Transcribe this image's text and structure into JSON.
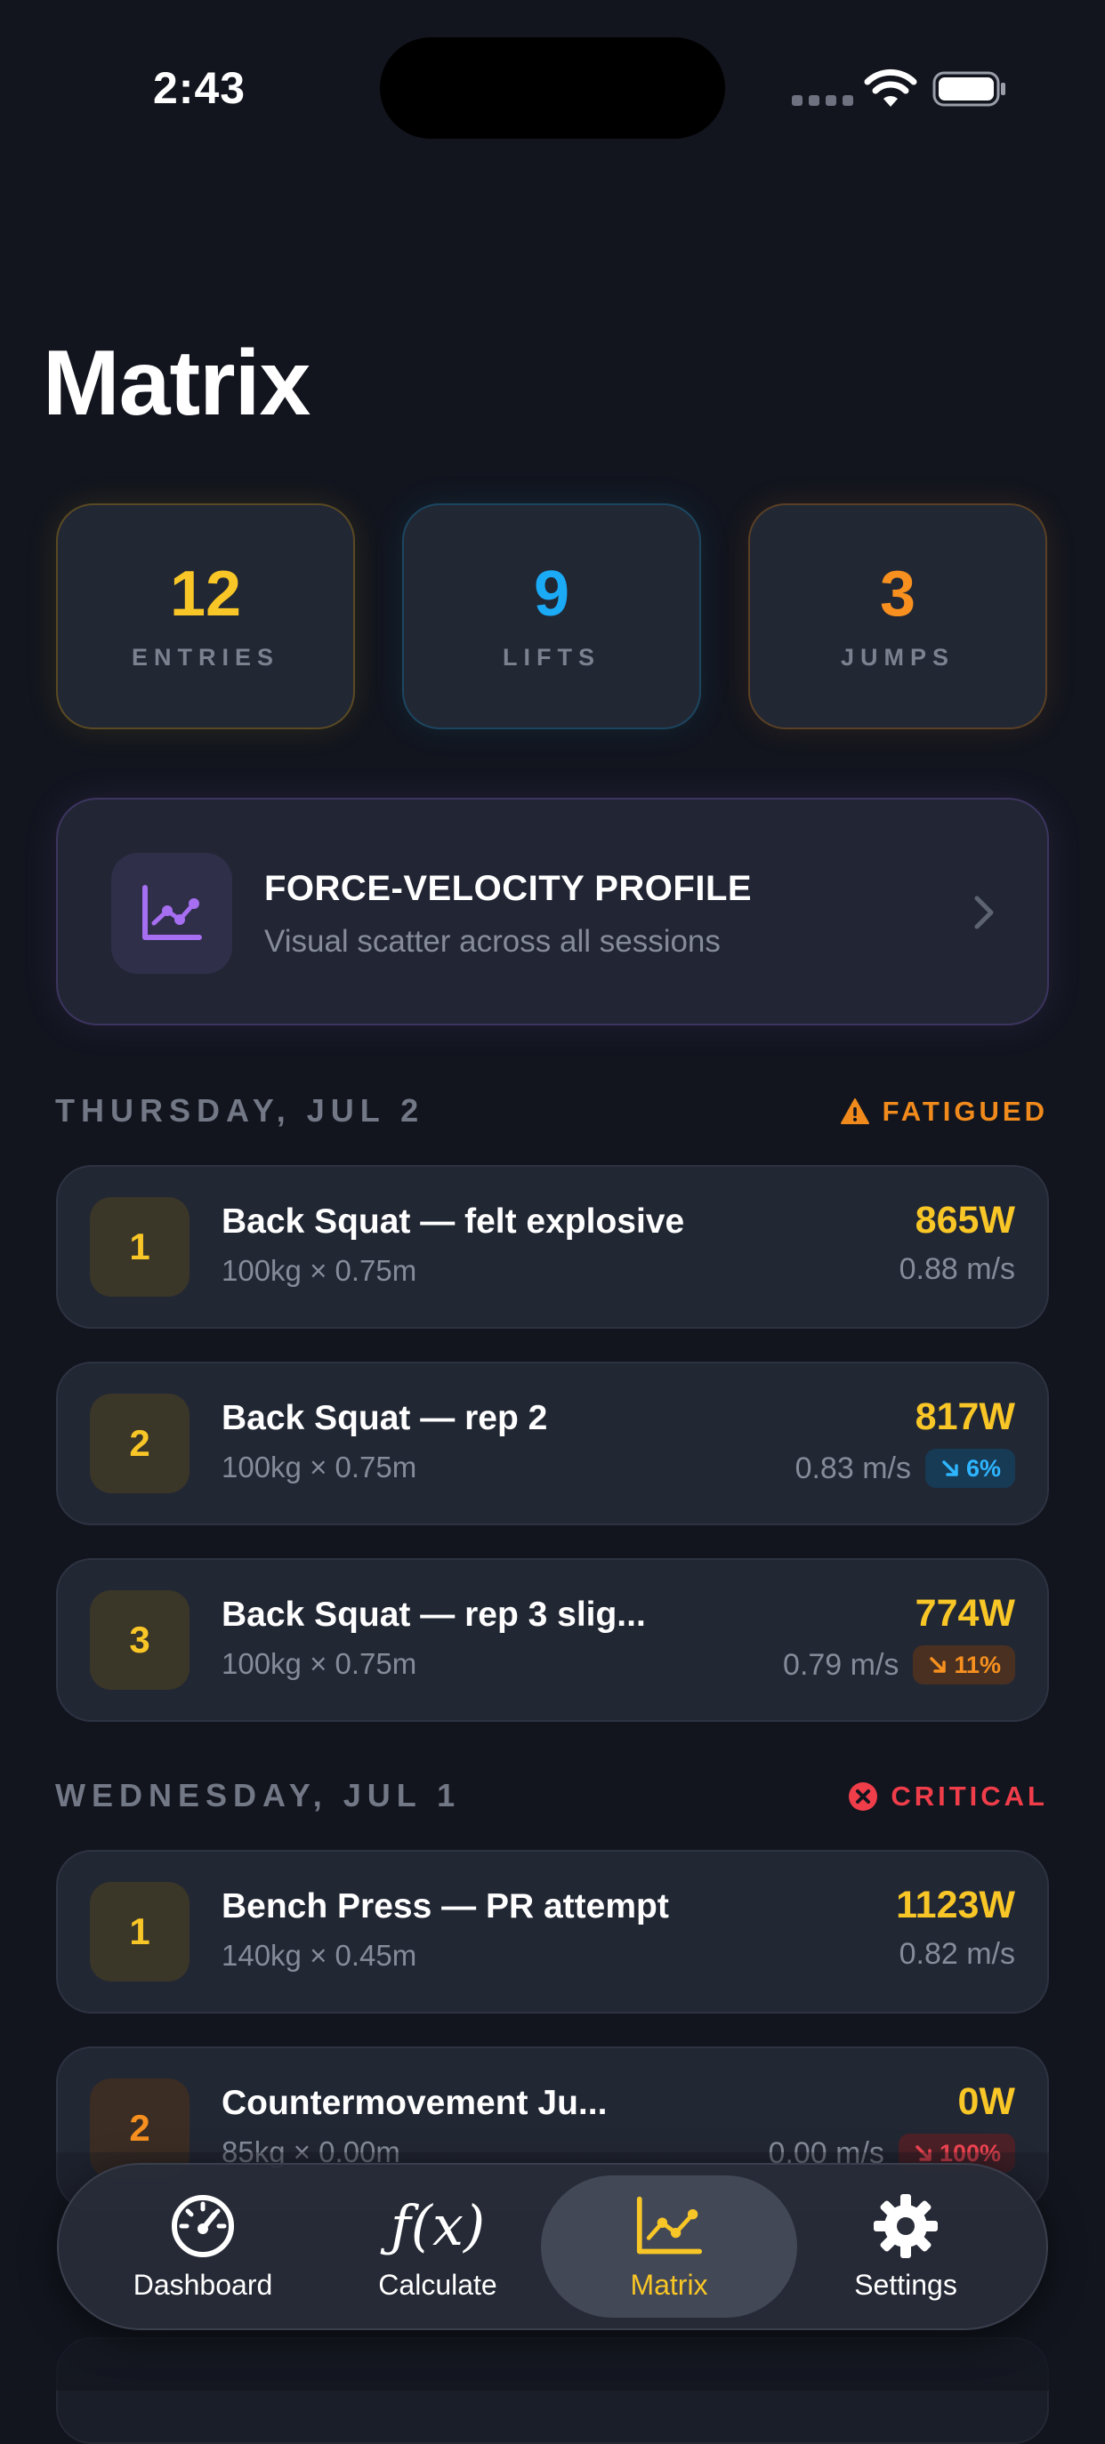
{
  "status_bar": {
    "time": "2:43"
  },
  "page": {
    "title": "Matrix"
  },
  "stats": [
    {
      "value": "12",
      "label": "ENTRIES"
    },
    {
      "value": "9",
      "label": "LIFTS"
    },
    {
      "value": "3",
      "label": "JUMPS"
    }
  ],
  "profile_card": {
    "title": "FORCE-VELOCITY PROFILE",
    "subtitle": "Visual scatter across all sessions",
    "icon": "line-chart-icon"
  },
  "sections": [
    {
      "date": "THURSDAY, JUL 2",
      "status": "FATIGUED",
      "status_icon": "warning-icon",
      "status_color": "#f08a1c",
      "entries": [
        {
          "rank": "1",
          "title": "Back Squat — felt explosive",
          "detail": "100kg × 0.75m",
          "power": "865W",
          "velocity": "0.88 m/s",
          "change": ""
        },
        {
          "rank": "2",
          "title": "Back Squat — rep 2",
          "detail": "100kg × 0.75m",
          "power": "817W",
          "velocity": "0.83 m/s",
          "change": "6%"
        },
        {
          "rank": "3",
          "title": "Back Squat — rep 3 slig...",
          "detail": "100kg × 0.75m",
          "power": "774W",
          "velocity": "0.79 m/s",
          "change": "11%"
        }
      ]
    },
    {
      "date": "WEDNESDAY, JUL 1",
      "status": "CRITICAL",
      "status_icon": "x-circle-icon",
      "status_color": "#ef3d4a",
      "entries": [
        {
          "rank": "1",
          "title": "Bench Press — PR attempt",
          "detail": "140kg × 0.45m",
          "power": "1123W",
          "velocity": "0.82 m/s",
          "change": ""
        },
        {
          "rank": "2",
          "title": "Countermovement Ju...",
          "detail": "85kg × 0.00m",
          "power": "0W",
          "velocity": "0.00 m/s",
          "change": "100%"
        }
      ]
    }
  ],
  "tab_bar": {
    "tabs": [
      {
        "label": "Dashboard",
        "icon": "speedometer-icon",
        "active": false
      },
      {
        "label": "Calculate",
        "icon": "function-icon",
        "active": false
      },
      {
        "label": "Matrix",
        "icon": "line-chart-icon",
        "active": true
      },
      {
        "label": "Settings",
        "icon": "gear-icon",
        "active": false
      }
    ]
  },
  "colors": {
    "accent_yellow": "#f8c626",
    "accent_blue": "#1aaaf6",
    "accent_orange": "#f7901f",
    "accent_red": "#ef3d4a",
    "accent_purple": "#a66ef0",
    "background": "#12151e"
  }
}
